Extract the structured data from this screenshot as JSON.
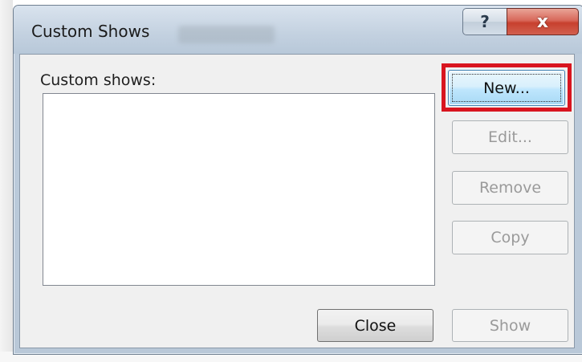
{
  "dialog": {
    "title": "Custom Shows",
    "help_label": "?",
    "close_label": "x"
  },
  "list": {
    "label": "Custom shows:",
    "items": []
  },
  "buttons": {
    "new": "New...",
    "edit": "Edit...",
    "remove": "Remove",
    "copy": "Copy",
    "close": "Close",
    "show": "Show"
  },
  "colors": {
    "highlight": "#d8151f",
    "primary_border": "#3c7fb1"
  }
}
